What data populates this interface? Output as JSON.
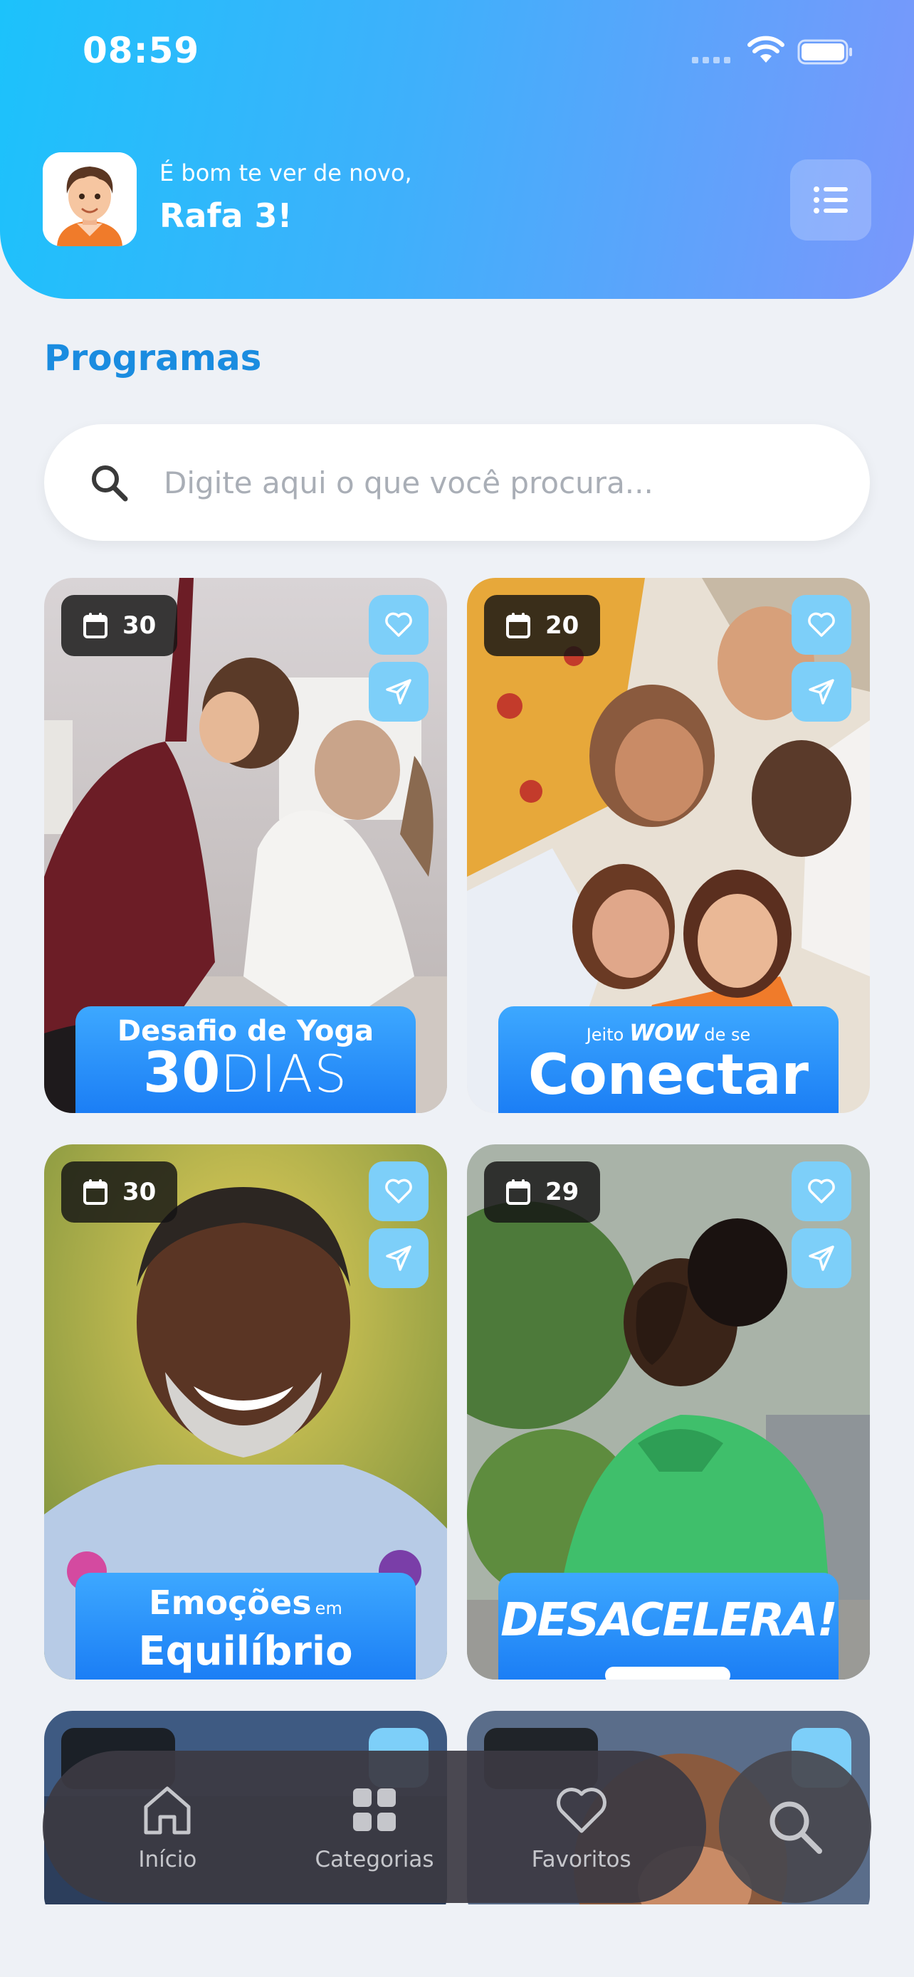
{
  "status_bar": {
    "time": "08:59"
  },
  "header": {
    "greeting": "É bom te ver de novo,",
    "user_name": "Rafa 3!"
  },
  "section_title": "Programas",
  "search": {
    "placeholder": "Digite aqui o que você procura..."
  },
  "programs": [
    {
      "days": "30",
      "banner_line1": "Desafio de Yoga",
      "banner_line2_bold": "30",
      "banner_line2_light": "DIAS"
    },
    {
      "days": "20",
      "banner_pre": "Jeito",
      "banner_wow": "WOW",
      "banner_post": "de se",
      "banner_main": "Conectar"
    },
    {
      "days": "30",
      "banner_line1": "Emoções",
      "banner_small": "em",
      "banner_line2": "Equilíbrio"
    },
    {
      "days": "29",
      "banner_main": "DESACELERA!"
    }
  ],
  "nav": {
    "home": "Início",
    "categories": "Categorias",
    "favorites": "Favoritos"
  },
  "colors": {
    "accent": "#1a8ce0",
    "header_start": "#1cc2fb",
    "header_end": "#7a97fb",
    "icon_button": "#7dcff9"
  }
}
